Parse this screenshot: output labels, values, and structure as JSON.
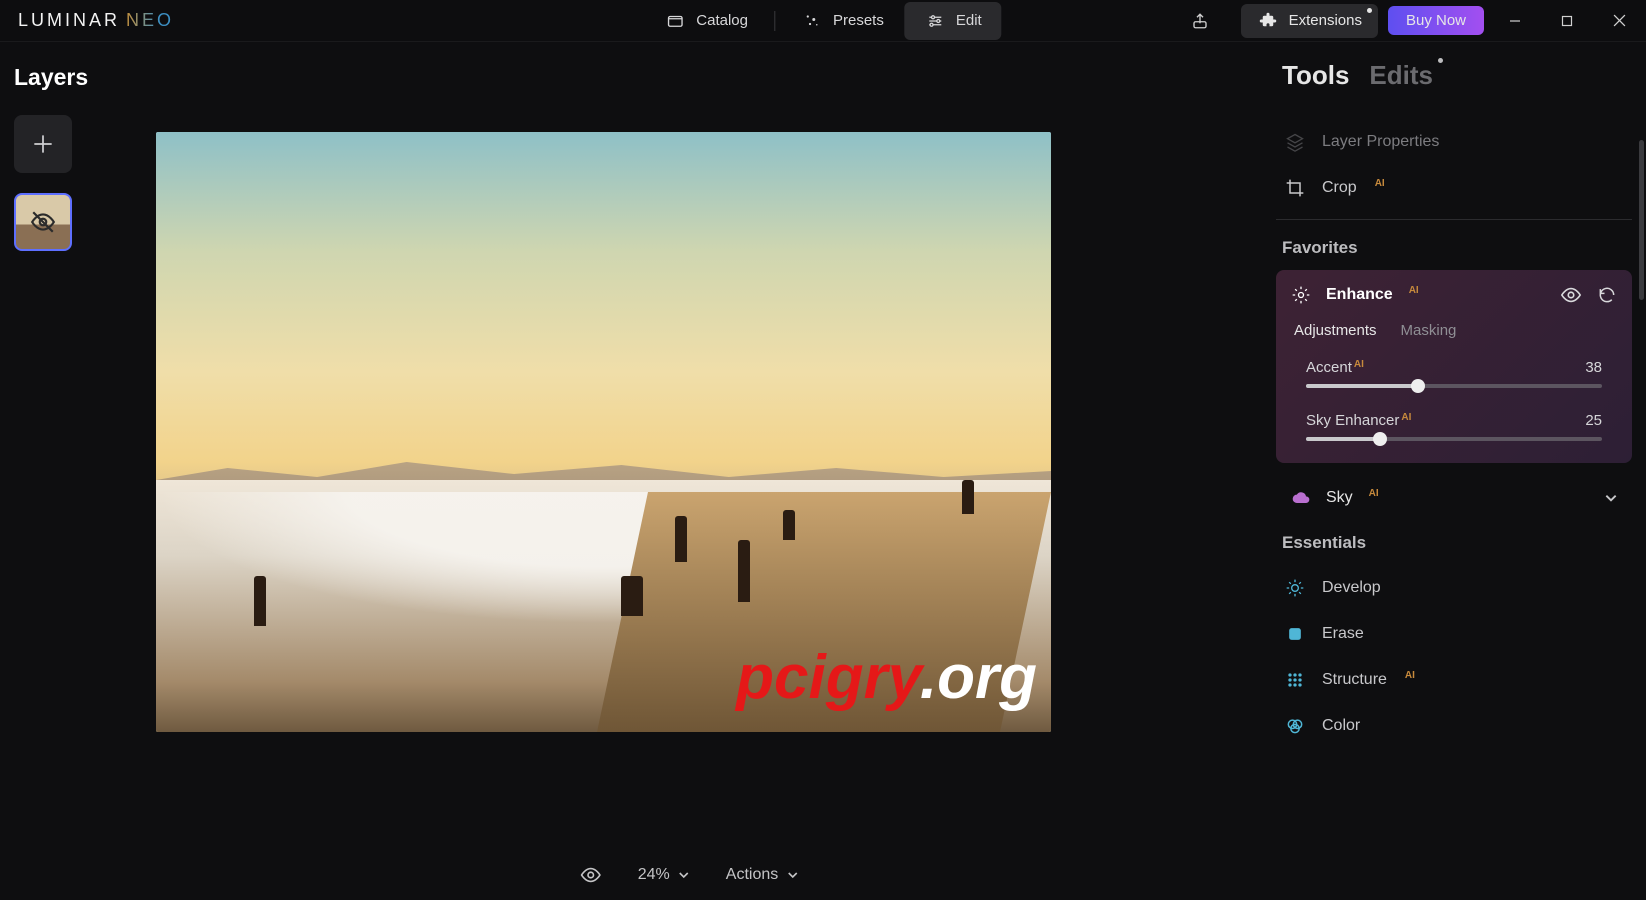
{
  "app": {
    "logo_a": "LUMINAR",
    "logo_b": "NEO"
  },
  "topnav": {
    "catalog": "Catalog",
    "presets": "Presets",
    "edit": "Edit",
    "extensions": "Extensions",
    "buy": "Buy Now"
  },
  "left": {
    "title": "Layers"
  },
  "footer": {
    "zoom": "24%",
    "actions": "Actions"
  },
  "rightTabs": {
    "tools": "Tools",
    "edits": "Edits"
  },
  "tools": {
    "layer_properties": "Layer Properties",
    "crop": "Crop",
    "favorites_section": "Favorites",
    "essentials_section": "Essentials",
    "sky": "Sky",
    "develop": "Develop",
    "erase": "Erase",
    "structure": "Structure",
    "color": "Color"
  },
  "enhance": {
    "title": "Enhance",
    "tab_adjustments": "Adjustments",
    "tab_masking": "Masking",
    "accent_label": "Accent",
    "accent_value": "38",
    "sky_label": "Sky Enhancer",
    "sky_value": "25"
  },
  "watermark": {
    "a": "pcigry",
    "b": ".org"
  },
  "ai_badge": "AI"
}
